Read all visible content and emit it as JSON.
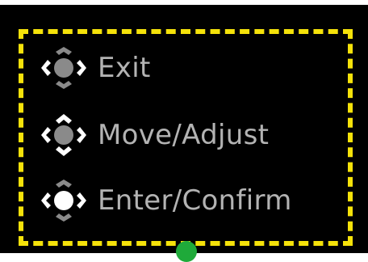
{
  "legend": {
    "items": [
      {
        "id": "exit",
        "label": "Exit",
        "icon": "joystick-left-right-icon"
      },
      {
        "id": "move",
        "label": "Move/Adjust",
        "icon": "joystick-all-directions-icon"
      },
      {
        "id": "enter",
        "label": "Enter/Confirm",
        "icon": "joystick-press-icon"
      }
    ]
  },
  "colors": {
    "background": "#000000",
    "frame_dash": "#f5e20a",
    "label": "#b3b3b3",
    "arrow_highlight": "#ffffff",
    "arrow_dim": "#8a8a8a",
    "center_dim": "#8a8a8a",
    "center_active": "#ffffff",
    "indicator": "#1faa3a"
  }
}
